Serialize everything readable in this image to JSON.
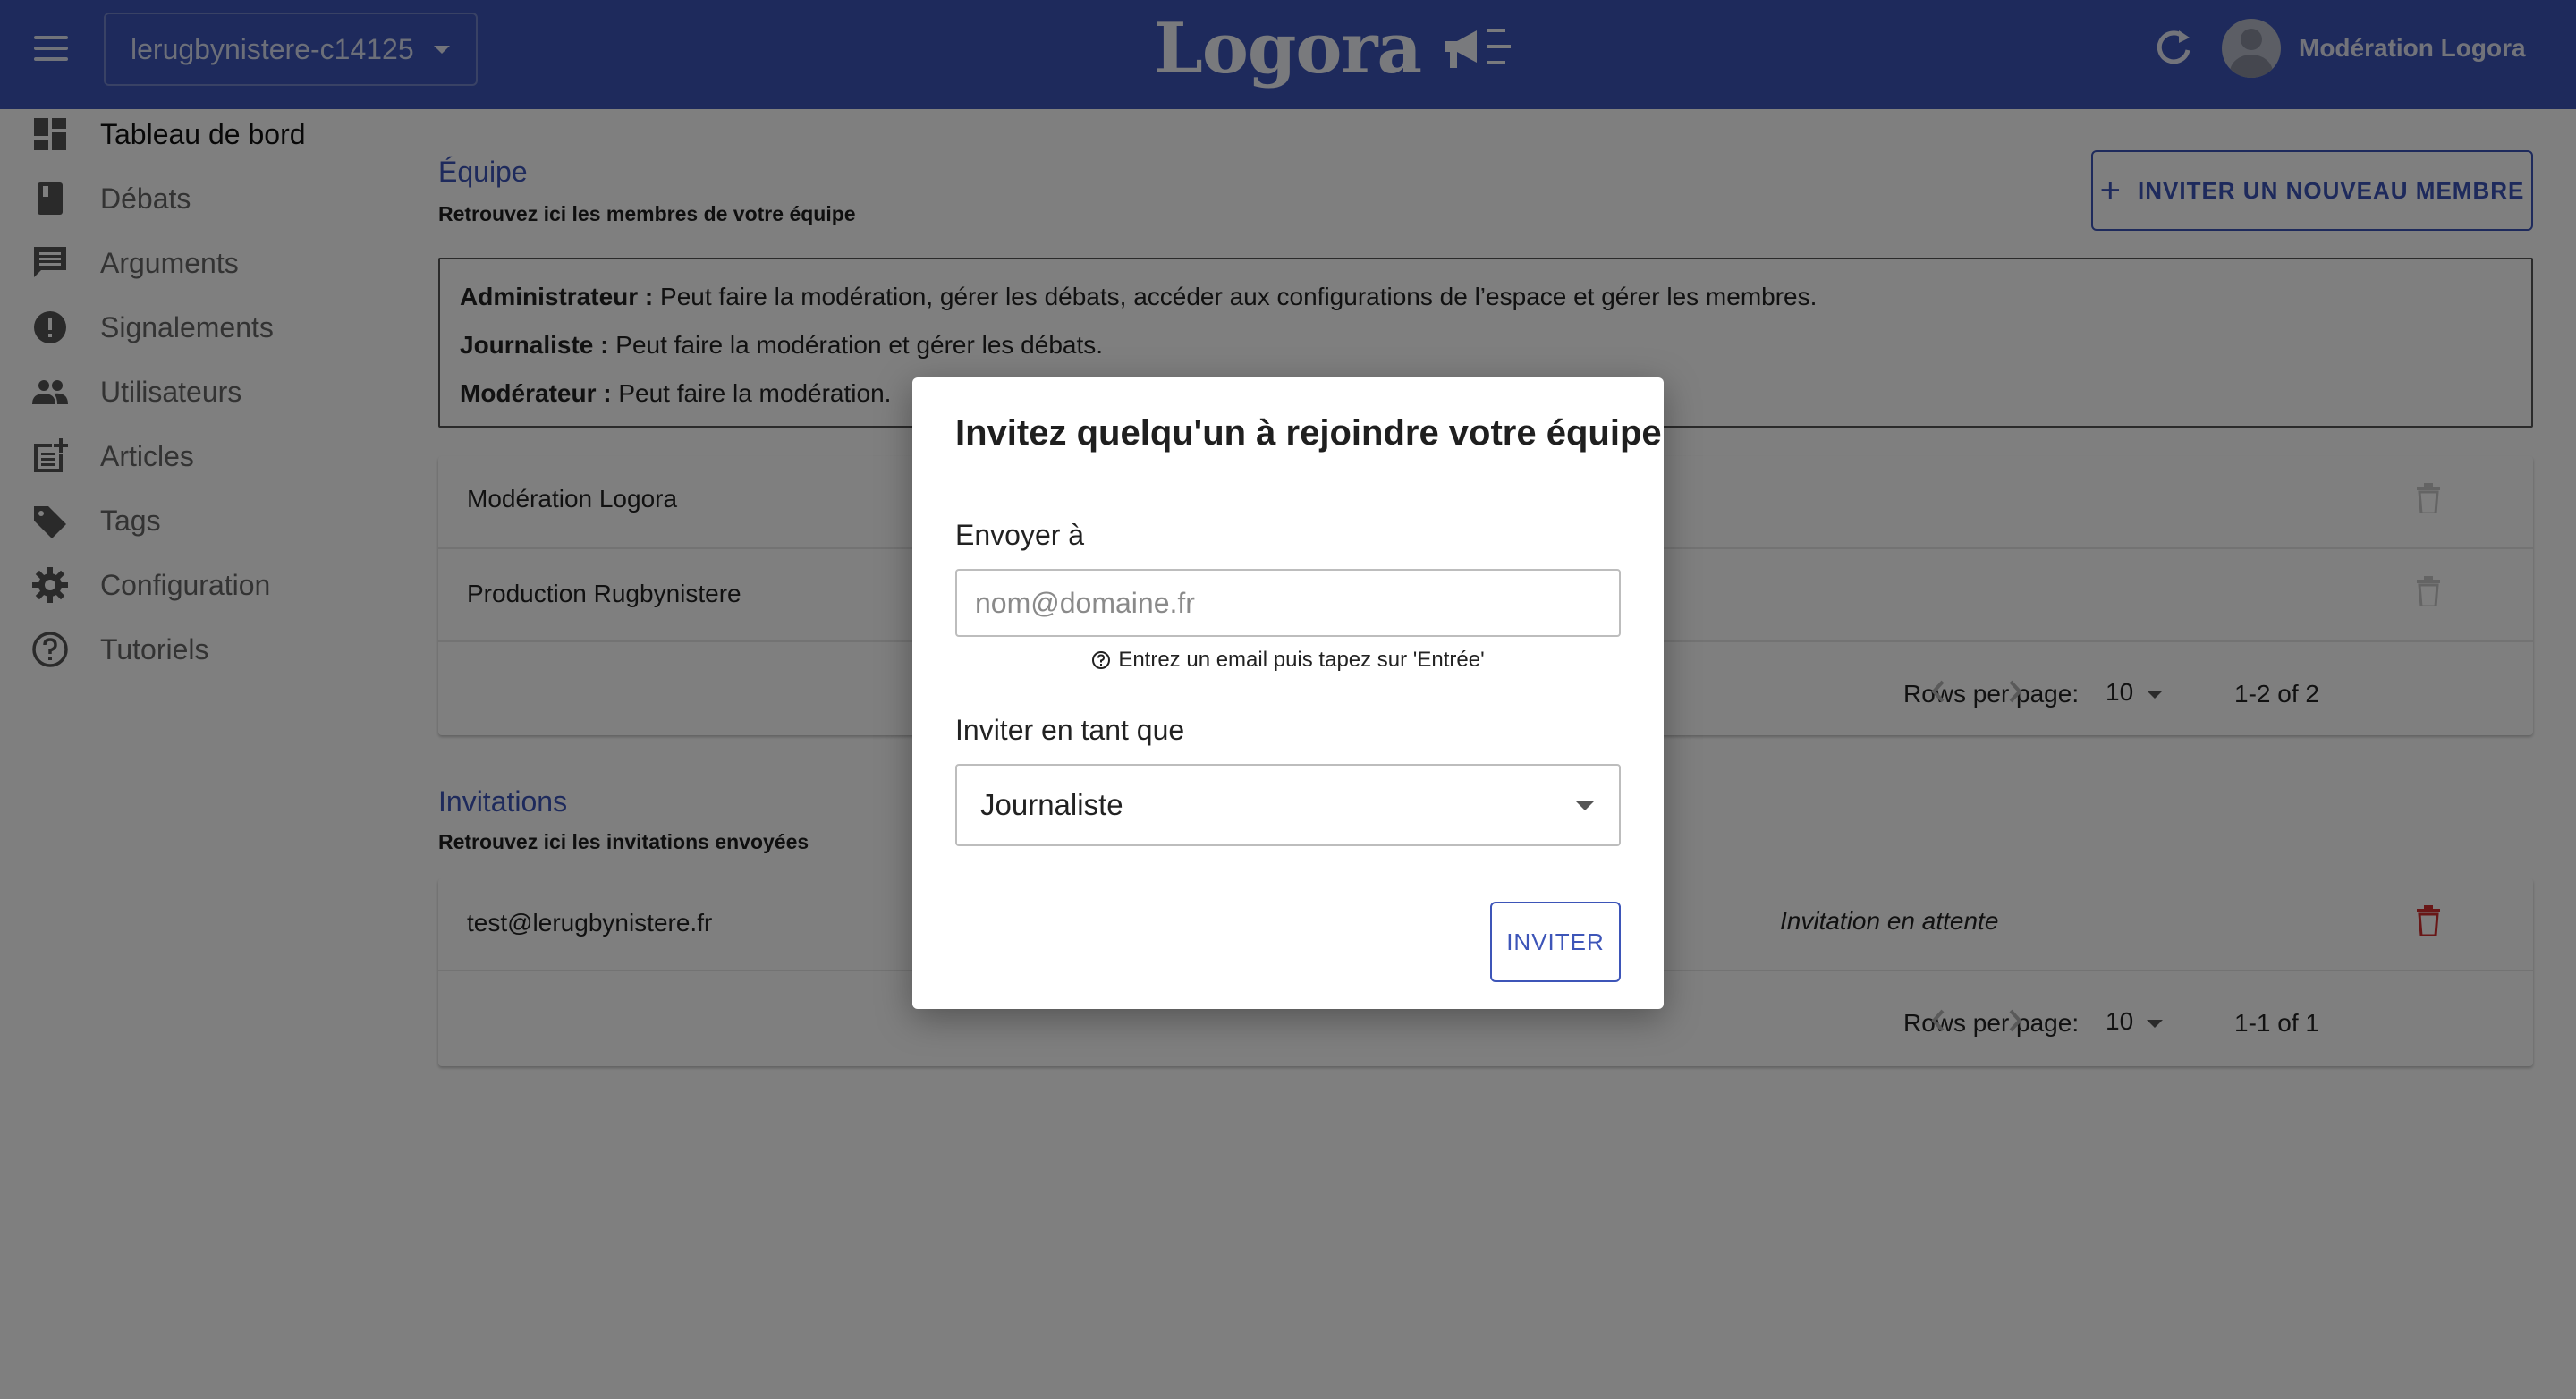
{
  "topbar": {
    "space_name": "lerugbynistere-c14125",
    "logo_text": "Logora",
    "user_name": "Modération Logora"
  },
  "sidebar": {
    "items": [
      {
        "label": "Tableau de bord",
        "icon": "dashboard-icon"
      },
      {
        "label": "Débats",
        "icon": "book-icon"
      },
      {
        "label": "Arguments",
        "icon": "comment-icon"
      },
      {
        "label": "Signalements",
        "icon": "alert-icon"
      },
      {
        "label": "Utilisateurs",
        "icon": "people-icon"
      },
      {
        "label": "Articles",
        "icon": "post-add-icon"
      },
      {
        "label": "Tags",
        "icon": "tag-icon"
      },
      {
        "label": "Configuration",
        "icon": "gear-icon"
      },
      {
        "label": "Tutoriels",
        "icon": "help-icon"
      }
    ]
  },
  "team": {
    "title": "Équipe",
    "subtitle": "Retrouvez ici les membres de votre équipe",
    "invite_button": "INVITER UN NOUVEAU MEMBRE",
    "roles": [
      {
        "name": "Administrateur :",
        "desc": "Peut faire la modération, gérer les débats, accéder aux configurations de l’espace et gérer les membres."
      },
      {
        "name": "Journaliste :",
        "desc": "Peut faire la modération et gérer les débats."
      },
      {
        "name": "Modérateur :",
        "desc": "Peut faire la modération."
      }
    ],
    "members": [
      "Modération Logora",
      "Production Rugbynistere"
    ],
    "pagination": {
      "rows_label": "Rows per page:",
      "rows_value": "10",
      "range": "1-2 of 2"
    }
  },
  "invitations": {
    "title": "Invitations",
    "subtitle": "Retrouvez ici les invitations envoyées",
    "rows": [
      {
        "email": "test@lerugbynistere.fr",
        "status": "Invitation en attente"
      }
    ],
    "pagination": {
      "rows_label": "Rows per page:",
      "rows_value": "10",
      "range": "1-1 of 1"
    }
  },
  "dialog": {
    "title": "Invitez quelqu'un à rejoindre votre équipe",
    "send_to_label": "Envoyer à",
    "email_placeholder": "nom@domaine.fr",
    "email_value": "",
    "hint": "Entrez un email puis tapez sur 'Entrée'",
    "role_label": "Inviter en tant que",
    "role_value": "Journaliste",
    "submit_label": "INVITER"
  },
  "colors": {
    "brand": "#3d55b8",
    "danger": "#d32f2f",
    "overlay": "rgba(0,0,0,0.5)"
  }
}
